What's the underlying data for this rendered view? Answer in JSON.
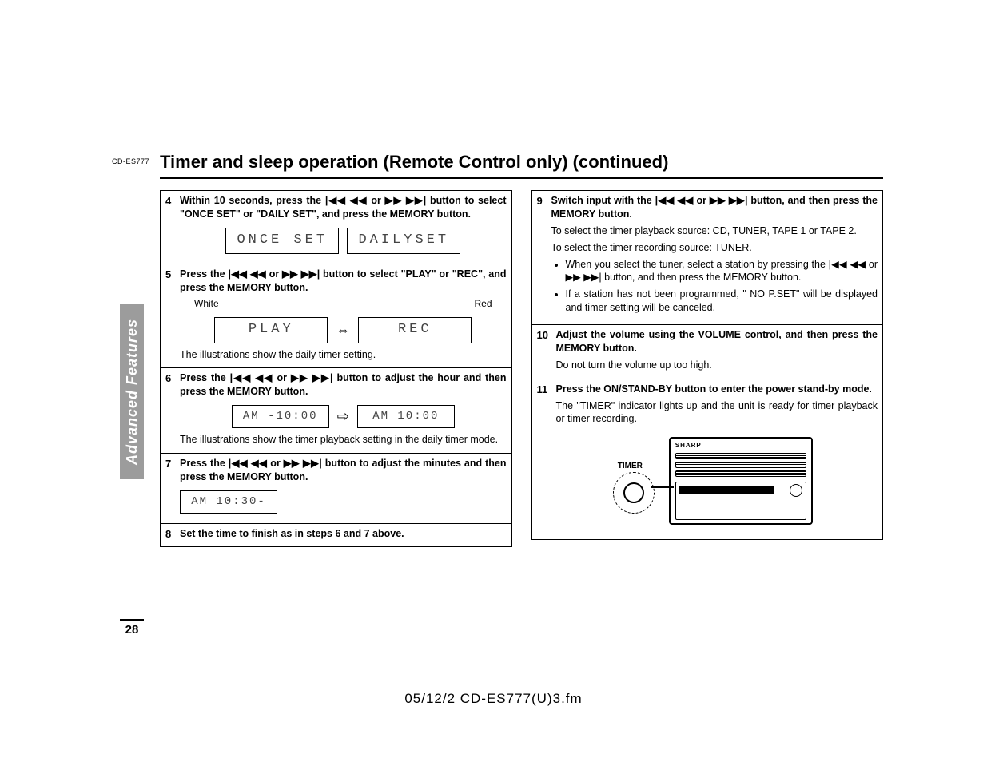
{
  "header": {
    "model": "CD-ES777",
    "title": "Timer and sleep operation (Remote Control only) (continued)"
  },
  "side_tab": "Advanced Features",
  "page_number": "28",
  "footer": "05/12/2     CD-ES777(U)3.fm",
  "icons": {
    "skip": "|◀◀ ◀◀ or ▶▶ ▶▶|"
  },
  "left_steps": {
    "s4": {
      "num": "4",
      "lead_a": "Within 10 seconds, press the ",
      "lead_b": " button to select \"ONCE SET\" or \"DAILY SET\", and press the MEMORY button.",
      "lcd1": "ONCE SET",
      "lcd2": "DAILYSET"
    },
    "s5": {
      "num": "5",
      "lead_a": "Press the ",
      "lead_b": " button to select \"PLAY\" or \"REC\", and press the MEMORY button.",
      "color_l": "White",
      "color_r": "Red",
      "lcd1": "PLAY",
      "lcd2": "REC",
      "caption": "The illustrations show the daily timer setting."
    },
    "s6": {
      "num": "6",
      "lead_a": "Press the ",
      "lead_b": " button to adjust the hour and then press the MEMORY button.",
      "lcd1": "AM  -10:00",
      "lcd2": "AM   10:00",
      "caption": "The illustrations show the timer playback setting in the daily timer mode."
    },
    "s7": {
      "num": "7",
      "lead_a": "Press the ",
      "lead_b": " button to adjust the minutes and then press the MEMORY button.",
      "lcd1": "AM   10:30-"
    },
    "s8": {
      "num": "8",
      "lead": "Set the time to finish as in steps 6 and 7 above."
    }
  },
  "right_steps": {
    "s9": {
      "num": "9",
      "lead_a": "Switch input with the ",
      "lead_b": " button, and then press the MEMORY button.",
      "line1": "To select the timer playback source: CD, TUNER, TAPE 1 or TAPE 2.",
      "line2": "To select the timer recording source: TUNER.",
      "bul1_a": "When you select the tuner, select a station by pressing the ",
      "bul1_b": " button, and then press the MEMORY button.",
      "bul2": "If a station has not been programmed, \" NO P.SET\" will be displayed and timer setting will be canceled."
    },
    "s10": {
      "num": "10",
      "lead": "Adjust the volume using the VOLUME control, and then press the MEMORY button.",
      "line1": "Do not turn the volume up too high."
    },
    "s11": {
      "num": "11",
      "lead": "Press the ON/STAND-BY button to enter the power stand-by mode.",
      "line1": "The \"TIMER\" indicator lights up and the unit is ready for timer playback or timer recording.",
      "timer_label": "TIMER",
      "brand": "SHARP"
    }
  }
}
